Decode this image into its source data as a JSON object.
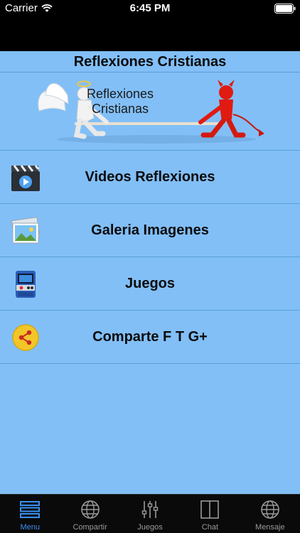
{
  "status_bar": {
    "carrier": "Carrier",
    "time": "6:45 PM"
  },
  "header": {
    "title": "Reflexiones Cristianas"
  },
  "banner": {
    "line1": "Reflexiones",
    "line2": "Cristianas"
  },
  "menu": {
    "items": [
      {
        "label": "Videos Reflexiones",
        "icon": "video-clapper-icon"
      },
      {
        "label": "Galeria Imagenes",
        "icon": "photo-gallery-icon"
      },
      {
        "label": "Juegos",
        "icon": "arcade-cabinet-icon"
      },
      {
        "label": "Comparte F T G+",
        "icon": "share-icon"
      }
    ]
  },
  "tabbar": {
    "tabs": [
      {
        "label": "Menu",
        "icon": "menu-icon",
        "active": true
      },
      {
        "label": "Compartir",
        "icon": "globe-icon",
        "active": false
      },
      {
        "label": "Juegos",
        "icon": "sliders-icon",
        "active": false
      },
      {
        "label": "Chat",
        "icon": "book-icon",
        "active": false
      },
      {
        "label": "Mensaje",
        "icon": "globe-icon",
        "active": false
      }
    ],
    "active_color": "#3a8ef0",
    "inactive_color": "#9a9a9a"
  },
  "colors": {
    "list_background": "#82bff7",
    "separator": "#5a9fd8"
  }
}
